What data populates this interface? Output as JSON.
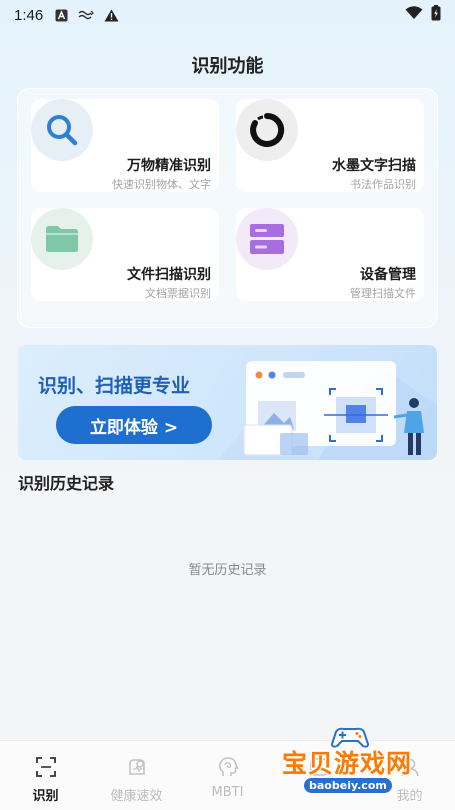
{
  "status_bar": {
    "time": "1:46",
    "left_icons": [
      "a-box-icon",
      "tilde-signal-icon",
      "warning-icon"
    ],
    "right_icons": [
      "wifi-icon",
      "battery-icon"
    ]
  },
  "header": {
    "title": "识别功能"
  },
  "features": [
    {
      "title": "万物精准识别",
      "subtitle": "快速识别物体、文字",
      "icon": "magnifier-icon",
      "color": "#2f7fd6"
    },
    {
      "title": "水墨文字扫描",
      "subtitle": "书法作品识别",
      "icon": "ink-ring-icon",
      "color": "#111111"
    },
    {
      "title": "文件扫描识别",
      "subtitle": "文档票据识别",
      "icon": "folder-icon",
      "color": "#7fc7a6"
    },
    {
      "title": "设备管理",
      "subtitle": "管理扫描文件",
      "icon": "storage-icon",
      "color": "#a86ee0"
    }
  ],
  "banner": {
    "headline": "识别、扫描更专业",
    "button_label": "立即体验 >"
  },
  "history": {
    "title": "识别历史记录",
    "empty_text": "暂无历史记录"
  },
  "tab_bar": {
    "tabs": [
      {
        "label": "识别",
        "icon": "scan-frame-icon",
        "active": true
      },
      {
        "label": "健康速效",
        "icon": "health-badge-icon",
        "active": false
      },
      {
        "label": "MBTI",
        "icon": "brain-head-icon",
        "active": false
      },
      {
        "label": "",
        "icon": "other-icon",
        "active": false
      },
      {
        "label": "我的",
        "icon": "profile-icon",
        "active": false
      }
    ]
  },
  "watermark": {
    "text": "宝贝游戏网",
    "url": "baobeiy.com"
  },
  "colors": {
    "accent": "#1e6fcf",
    "banner_text": "#1f5fb5",
    "inactive_tab": "#bdbdbd"
  }
}
